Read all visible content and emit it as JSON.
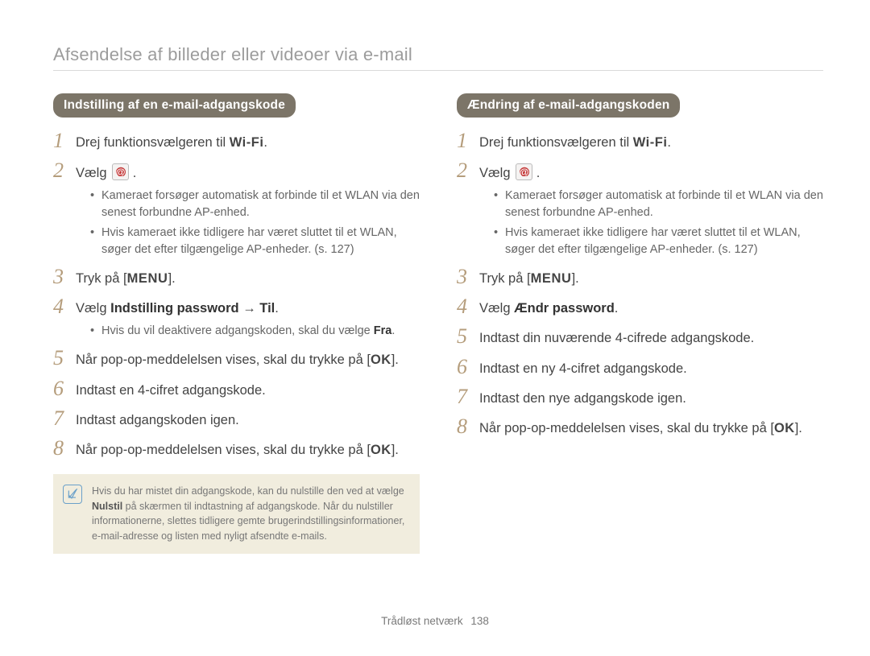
{
  "page_title": "Afsendelse af billeder eller videoer via e-mail",
  "footer_label": "Trådløst netværk",
  "footer_page": "138",
  "common": {
    "step1_prefix": "Drej funktionsvælgeren til ",
    "wifi_label": "Wi-Fi",
    "step2_verb": "Vælg ",
    "email_icon_name": "email-app-icon",
    "bullet_a": "Kameraet forsøger automatisk at forbinde til et WLAN via den senest forbundne AP-enhed.",
    "bullet_b": "Hvis kameraet ikke tidligere har været sluttet til et WLAN, søger det efter tilgængelige AP-enheder. (s. 127)",
    "tryk_paa": "Tryk på [",
    "menu_label": "MENU",
    "close_bracket_dot": "].",
    "ok_label": "OK"
  },
  "left": {
    "subtitle": "Indstilling af en e-mail-adgangskode",
    "step4_prefix": "Vælg ",
    "step4_bold": "Indstilling password",
    "step4_arrow": " → ",
    "step4_bold2": "Til",
    "step4_suffix": ".",
    "step4_bullet": "Hvis du vil deaktivere adgangskoden, skal du vælge ",
    "step4_bullet_bold": "Fra",
    "step4_bullet_suffix": ".",
    "step5_prefix": "Når pop-op-meddelelsen vises, skal du trykke på [",
    "step5_suffix": "].",
    "step6": "Indtast en 4-cifret adgangskode.",
    "step7": "Indtast adgangskoden igen.",
    "step8_prefix": "Når pop-op-meddelelsen vises, skal du trykke på [",
    "step8_suffix": "].",
    "note_prefix": "Hvis du har mistet din adgangskode, kan du nulstille den ved at vælge ",
    "note_bold": "Nulstil",
    "note_suffix": " på skærmen til indtastning af adgangskode. Når du nulstiller informationerne, slettes tidligere gemte brugerindstillingsinformationer, e-mail-adresse og listen med nyligt afsendte e-mails."
  },
  "right": {
    "subtitle": "Ændring af e-mail-adgangskoden",
    "step4_prefix": "Vælg ",
    "step4_bold": "Ændr password",
    "step4_suffix": ".",
    "step5": "Indtast din nuværende 4-cifrede adgangskode.",
    "step6": "Indtast en ny 4-cifret adgangskode.",
    "step7": "Indtast den nye adgangskode igen.",
    "step8_prefix": "Når pop-op-meddelelsen vises, skal du trykke på [",
    "step8_suffix": "]."
  }
}
